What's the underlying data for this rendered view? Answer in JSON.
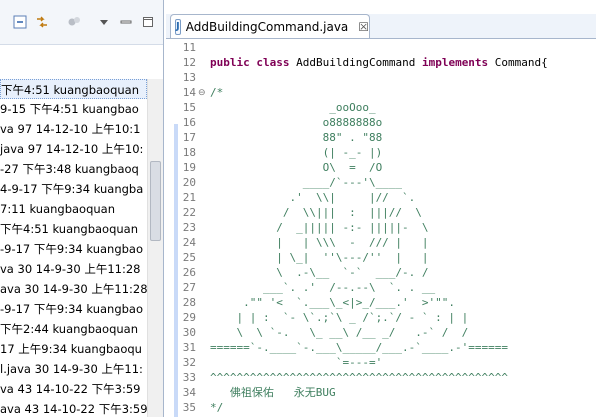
{
  "left_panel": {
    "toolbar_icons": [
      "collapse-icon",
      "link-icon",
      "filter-icon",
      "view-menu-icon",
      "minimize-icon",
      "maximize-icon"
    ],
    "rows": [
      "下午4:51  kuangbaoquan",
      "9-15 下午4:51  kuangbao",
      "va 97  14-12-10 上午10:1",
      "java 97  14-12-10 上午10:",
      "-27 下午3:48  kuangbaoq",
      "4-9-17 下午9:34  kuangba",
      "7:11  kuangbaoquan",
      "下午4:51  kuangbaoquan",
      "-9-17 下午9:34  kuangbao",
      "va 30  14-9-30 上午11:28",
      "ava 30  14-9-30 上午11:28",
      "-9-17 下午9:34  kuangbao",
      "下午2:44  kuangbaoquan",
      "17 上午9:34  kuangbaoqu",
      "l.java 30  14-9-30 上午11:",
      "va 43  14-10-22 下午3:59",
      "ava 43  14-10-22 下午3:59"
    ]
  },
  "editor": {
    "tab_title": "AddBuildingCommand.java",
    "tab_close": "☒",
    "lines": [
      {
        "n": "11",
        "fold": "",
        "text": "",
        "type": "code"
      },
      {
        "n": "12",
        "fold": "",
        "type": "class",
        "kw1": "public",
        "kw2": "class",
        "name": " AddBuildingCommand ",
        "kw3": "implements",
        "rest": " Command{"
      },
      {
        "n": "13",
        "fold": "",
        "text": "",
        "type": "code"
      },
      {
        "n": "14",
        "fold": "⊖",
        "text": "/*",
        "type": "comment"
      },
      {
        "n": "15",
        "fold": "",
        "text": "                  _ooOoo_",
        "type": "comment"
      },
      {
        "n": "16",
        "fold": "",
        "text": "                 o8888888o",
        "type": "comment"
      },
      {
        "n": "17",
        "fold": "",
        "text": "                 88\" . \"88",
        "type": "comment"
      },
      {
        "n": "18",
        "fold": "",
        "text": "                 (| -_- |)",
        "type": "comment"
      },
      {
        "n": "19",
        "fold": "",
        "text": "                 O\\  =  /O",
        "type": "comment"
      },
      {
        "n": "20",
        "fold": "",
        "text": "              ____/`---'\\____",
        "type": "comment"
      },
      {
        "n": "21",
        "fold": "",
        "text": "            .'  \\\\|     |//  `.",
        "type": "comment"
      },
      {
        "n": "22",
        "fold": "",
        "text": "           /  \\\\|||  :  |||//  \\",
        "type": "comment"
      },
      {
        "n": "23",
        "fold": "",
        "text": "          /  _||||| -:- |||||-  \\",
        "type": "comment"
      },
      {
        "n": "24",
        "fold": "",
        "text": "          |   | \\\\\\  -  /// |   |",
        "type": "comment"
      },
      {
        "n": "25",
        "fold": "",
        "text": "          | \\_|  ''\\---/''  |   |",
        "type": "comment"
      },
      {
        "n": "26",
        "fold": "",
        "text": "          \\  .-\\__  `-`  ___/-. /",
        "type": "comment"
      },
      {
        "n": "27",
        "fold": "",
        "text": "        ___`. .'  /--.--\\  `. . __",
        "type": "comment"
      },
      {
        "n": "28",
        "fold": "",
        "text": "     .\"\" '<  `.___\\_<|>_/___.'  >'\"\".",
        "type": "comment"
      },
      {
        "n": "29",
        "fold": "",
        "text": "    | | :  `- \\`.;`\\ _ /`;.`/ - ` : | |",
        "type": "comment"
      },
      {
        "n": "30",
        "fold": "",
        "text": "    \\  \\ `-.   \\_ __\\ /__ _/   .-` /  /",
        "type": "comment"
      },
      {
        "n": "31",
        "fold": "",
        "text": "======`-.____`-.___\\_____/___.-`____.-'======",
        "type": "comment"
      },
      {
        "n": "32",
        "fold": "",
        "text": "                   `=---='",
        "type": "comment"
      },
      {
        "n": "33",
        "fold": "",
        "text": "^^^^^^^^^^^^^^^^^^^^^^^^^^^^^^^^^^^^^^^^^^^^^",
        "type": "comment"
      },
      {
        "n": "34",
        "fold": "",
        "text": "   佛祖保佑   永无BUG",
        "type": "comment"
      },
      {
        "n": "35",
        "fold": "",
        "text": "*/",
        "type": "comment"
      }
    ]
  },
  "colors": {
    "keyword": "#7f0055",
    "comment": "#3f7f5f",
    "line_number": "#7a7a7a"
  }
}
